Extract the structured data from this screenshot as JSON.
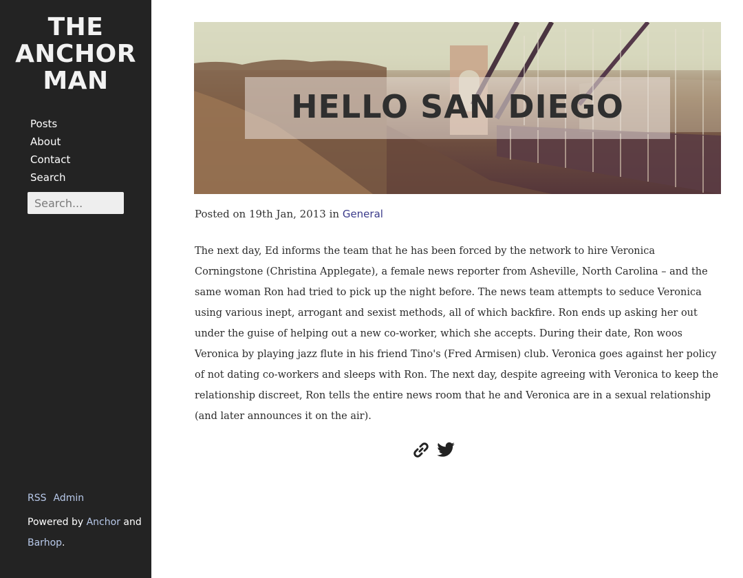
{
  "site": {
    "title_lines": [
      "THE",
      "ANCHOR",
      "MAN"
    ]
  },
  "nav": {
    "items": [
      {
        "label": "Posts"
      },
      {
        "label": "About"
      },
      {
        "label": "Contact"
      },
      {
        "label": "Search"
      }
    ]
  },
  "search": {
    "placeholder": "Search..."
  },
  "footer": {
    "rss": "RSS",
    "admin": "Admin",
    "powered_prefix": "Powered by",
    "anchor": "Anchor",
    "and": "and",
    "barhop": "Barhop",
    "period": "."
  },
  "post": {
    "title": "HELLO SAN DIEGO",
    "meta_prefix": "Posted on 19th Jan, 2013 in",
    "category": "General",
    "body": "The next day, Ed informs the team that he has been forced by the network to hire Veronica Corningstone (Christina Applegate), a female news reporter from Asheville, North Carolina – and the same woman Ron had tried to pick up the night before. The news team attempts to seduce Veronica using various inept, arrogant and sexist methods, all of which backfire. Ron ends up asking her out under the guise of helping out a new co-worker, which she accepts. During their date, Ron woos Veronica by playing jazz flute in his friend Tino's (Fred Armisen) club. Veronica goes against her policy of not dating co-workers and sleeps with Ron. The next day, despite agreeing with Veronica to keep the relationship discreet, Ron tells the entire news room that he and Veronica are in a sexual relationship (and later announces it on the air)."
  },
  "share": {
    "icons": [
      "link-icon",
      "twitter-icon"
    ]
  },
  "colors": {
    "sidebar_bg": "#232323",
    "link": "#b8c9ea",
    "category_link": "#3a3a8a"
  }
}
